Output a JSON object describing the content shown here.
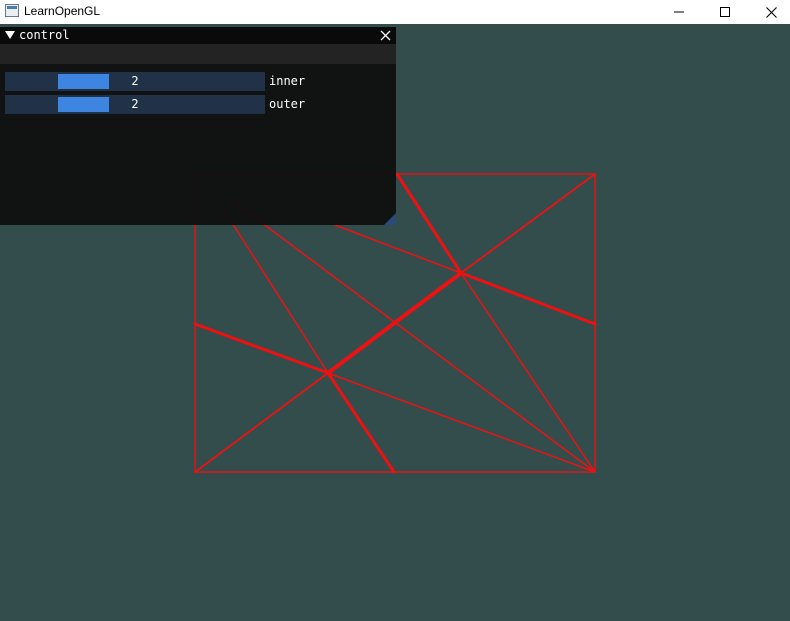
{
  "window": {
    "title": "LearnOpenGL",
    "icons": {
      "app": "app-window-icon",
      "minimize": "minimize-icon",
      "maximize": "maximize-icon",
      "close": "close-icon"
    }
  },
  "scene": {
    "clear_color": "#334d4d",
    "wire_color": "#ee1111"
  },
  "control_panel": {
    "title": "control",
    "icons": {
      "collapse": "collapse-triangle-icon",
      "close": "close-icon",
      "resize": "resize-grip-icon"
    },
    "sliders": [
      {
        "label": "inner",
        "value": "2"
      },
      {
        "label": "outer",
        "value": "2"
      }
    ],
    "accent_color": "#3d85e0"
  }
}
